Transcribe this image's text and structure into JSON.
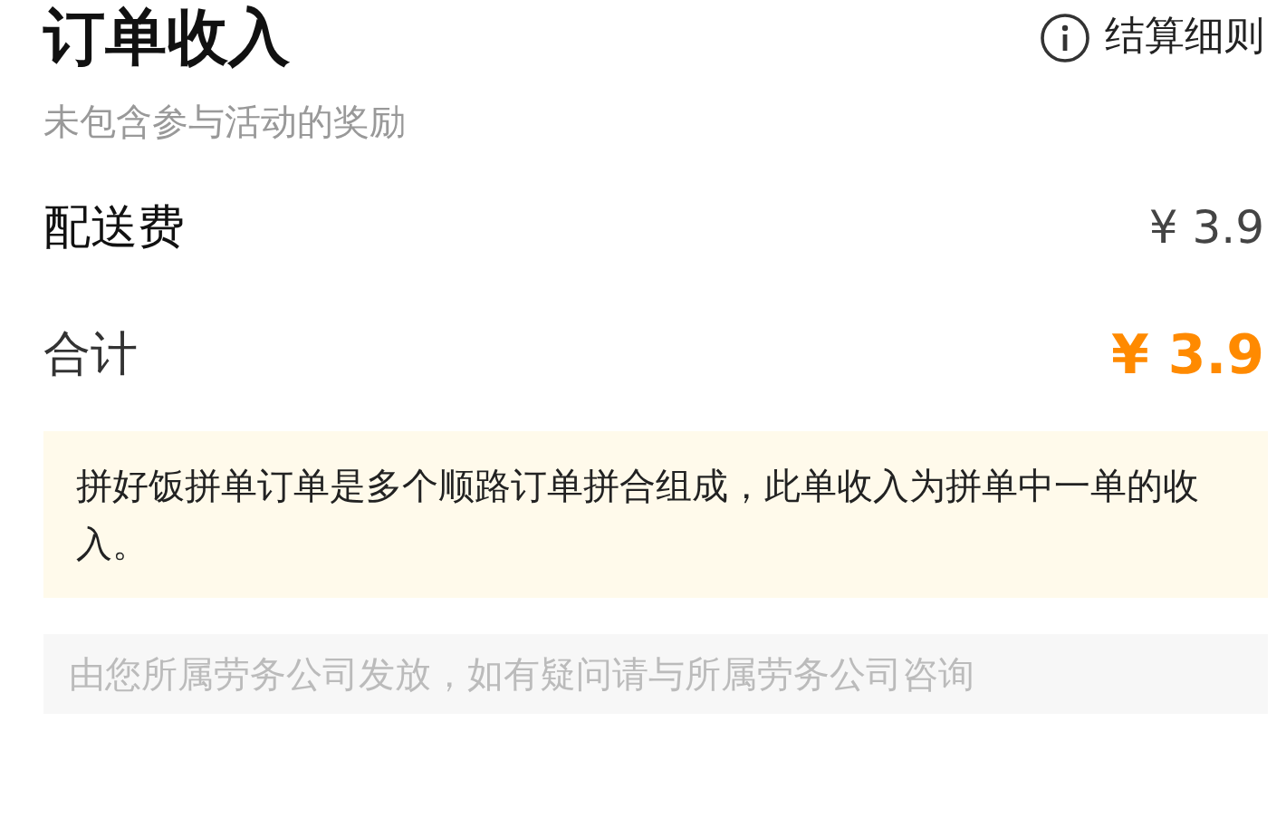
{
  "header": {
    "title": "订单收入",
    "subtitle": "未包含参与活动的奖励",
    "link": "结算细则"
  },
  "rows": [
    {
      "label": "配送费",
      "value": "¥ 3.9",
      "kind": "item"
    },
    {
      "label": "合计",
      "value": "¥ 3.9",
      "kind": "total"
    }
  ],
  "notice": "拼好饭拼单订单是多个顺路订单拼合组成，此单收入为拼单中一单的收入。",
  "footer": "由您所属劳务公司发放，如有疑问请与所属劳务公司咨询"
}
